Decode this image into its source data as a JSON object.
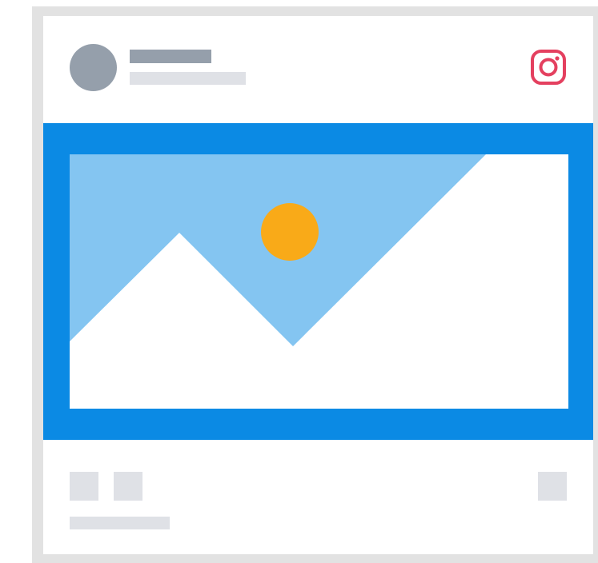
{
  "post": {
    "platform_icon": "instagram-icon",
    "colors": {
      "frame": "#e2e2e2",
      "card": "#ffffff",
      "avatar": "#959fab",
      "name_placeholder": "#959fab",
      "text_placeholder": "#dfe1e6",
      "instagram": "#e4405f",
      "media_background": "#0b8ae4",
      "sky": "#84c5f1",
      "sun": "#f9aa18",
      "mountain": "#ffffff"
    },
    "media": {
      "icon": "image-placeholder-icon",
      "elements": [
        "mountain",
        "sun",
        "sky"
      ]
    },
    "actions": {
      "like_icon": "like-placeholder",
      "comment_icon": "comment-placeholder",
      "bookmark_icon": "bookmark-placeholder"
    }
  }
}
